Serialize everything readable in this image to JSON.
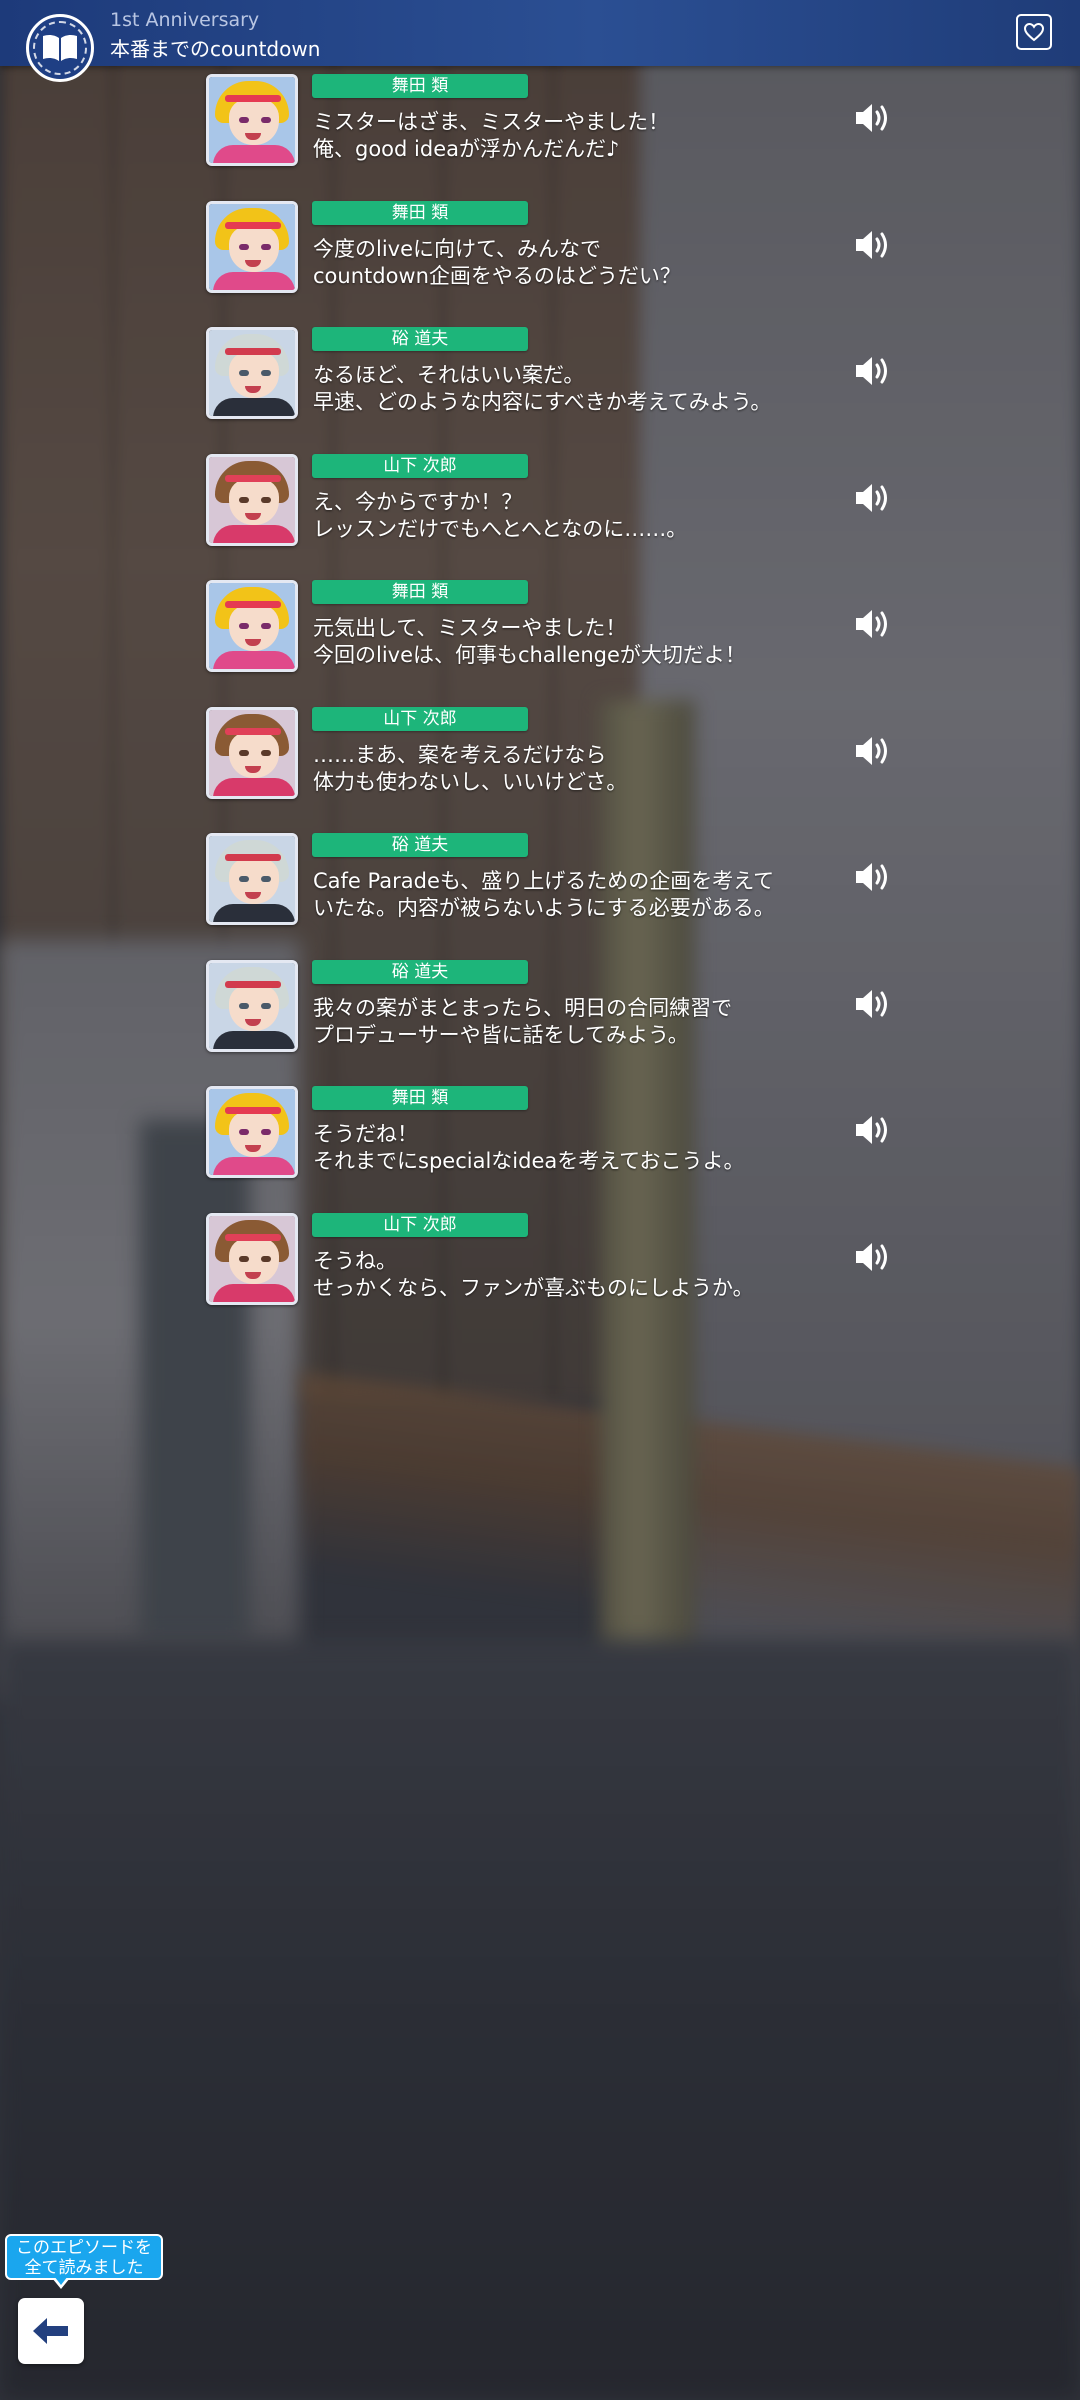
{
  "header": {
    "subtitle": "1st Anniversary",
    "title": "本番までのcountdown"
  },
  "icons": {
    "book": "open-book-icon",
    "favorite": "heart-icon",
    "voice": "speaker-icon",
    "back": "left-arrow-icon"
  },
  "colors": {
    "header_bg": "#2b4f93",
    "name_tag": "#1db57a",
    "badge": "#1aa6ee"
  },
  "entries": [
    {
      "speaker": "舞田 類",
      "avatar": "blonde",
      "line1": "ミスターはざま、ミスターやました！",
      "line2": "俺、good ideaが浮かんだんだ♪"
    },
    {
      "speaker": "舞田 類",
      "avatar": "blonde",
      "line1": "今度のliveに向けて、みんなで",
      "line2": "countdown企画をやるのはどうだい？"
    },
    {
      "speaker": "硲 道夫",
      "avatar": "silver",
      "line1": "なるほど、それはいい案だ。",
      "line2": "早速、どのような内容にすべきか考えてみよう。"
    },
    {
      "speaker": "山下 次郎",
      "avatar": "brown",
      "line1": "え、今からですか！？",
      "line2": "レッスンだけでもへとへとなのに……。"
    },
    {
      "speaker": "舞田 類",
      "avatar": "blonde",
      "line1": "元気出して、ミスターやました！",
      "line2": "今回のliveは、何事もchallengeが大切だよ！"
    },
    {
      "speaker": "山下 次郎",
      "avatar": "brown",
      "line1": "……まあ、案を考えるだけなら",
      "line2": "体力も使わないし、いいけどさ。"
    },
    {
      "speaker": "硲 道夫",
      "avatar": "silver",
      "line1": "Cafe Paradeも、盛り上げるための企画を考えて",
      "line2": "いたな。内容が被らないようにする必要がある。"
    },
    {
      "speaker": "硲 道夫",
      "avatar": "silver",
      "line1": "我々の案がまとまったら、明日の合同練習で",
      "line2": "プロデューサーや皆に話をしてみよう。"
    },
    {
      "speaker": "舞田 類",
      "avatar": "blonde",
      "line1": "そうだね！",
      "line2": "それまでにspecialなideaを考えておこうよ。"
    },
    {
      "speaker": "山下 次郎",
      "avatar": "brown",
      "line1": "そうね。",
      "line2": "せっかくなら、ファンが喜ぶものにしようか。"
    }
  ],
  "footer": {
    "complete_line1": "このエピソードを",
    "complete_line2": "全て読みました"
  }
}
